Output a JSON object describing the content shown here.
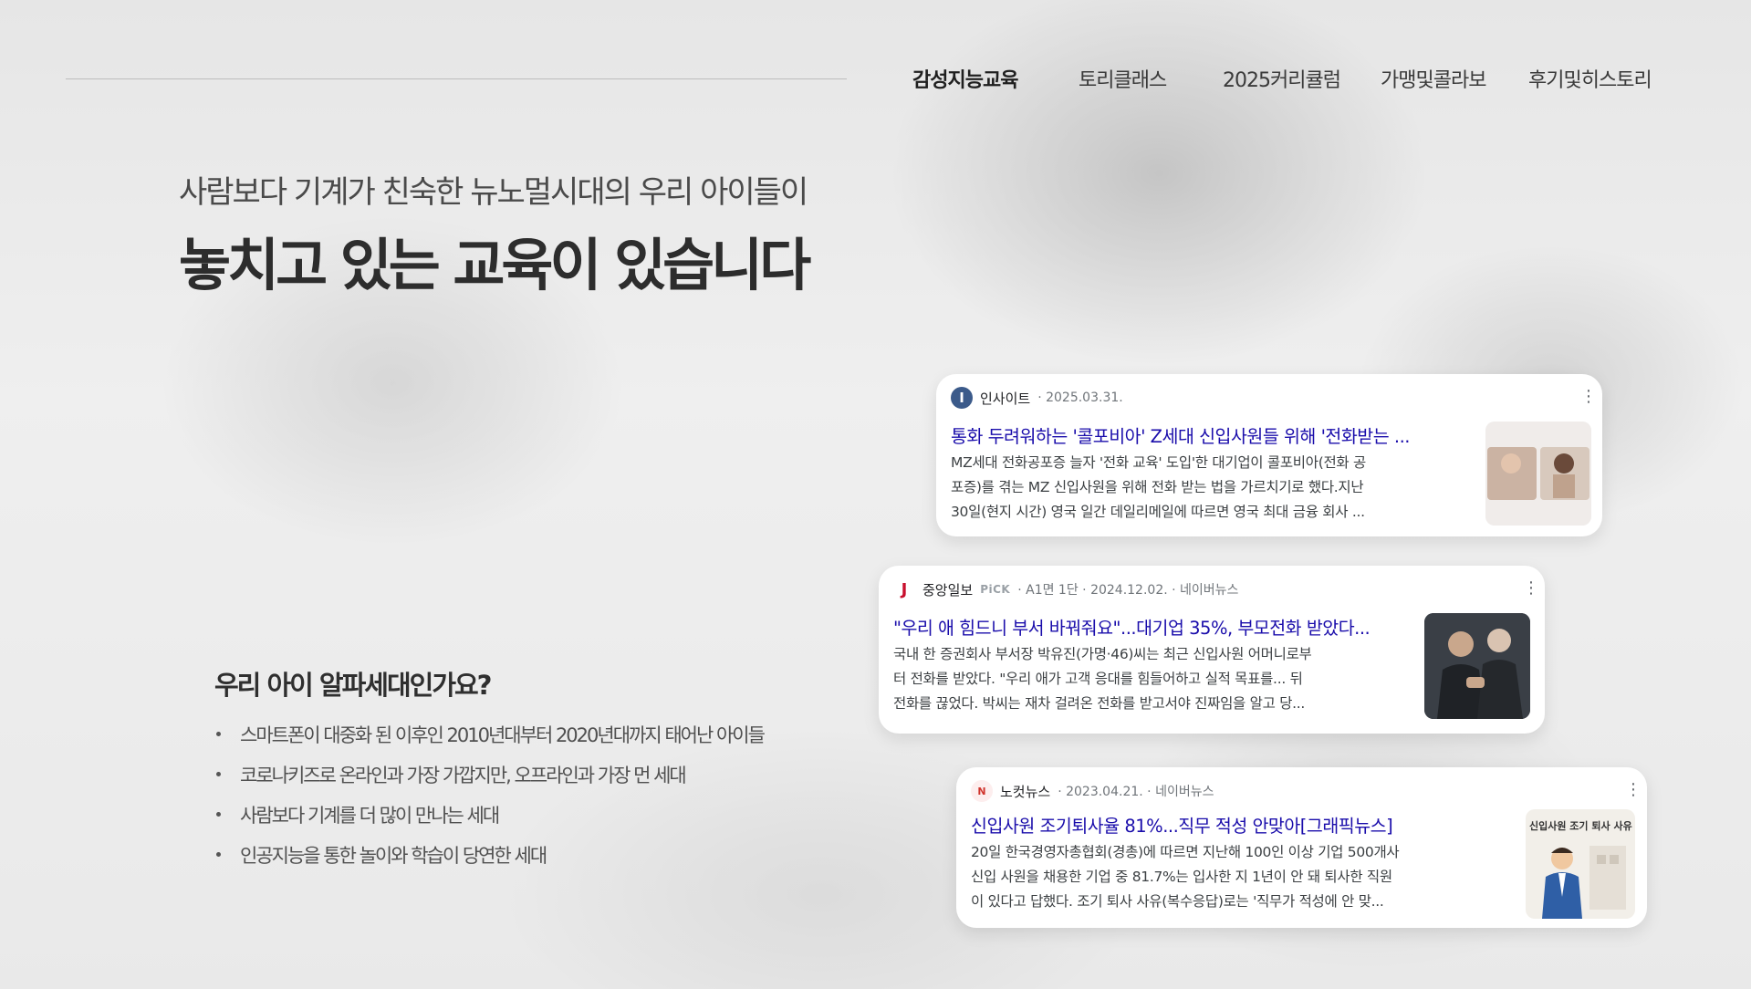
{
  "nav": {
    "items": [
      {
        "label": "감성지능교육",
        "active": true
      },
      {
        "label": "토리클래스",
        "active": false
      },
      {
        "label": "2025커리큘럼",
        "active": false
      },
      {
        "label": "가맹및콜라보",
        "active": false
      },
      {
        "label": "후기및히스토리",
        "active": false
      }
    ]
  },
  "hero": {
    "subhead": "사람보다 기계가 친숙한 뉴노멀시대의 우리 아이들이",
    "headline": "놓치고 있는 교육이 있습니다"
  },
  "alpha": {
    "title": "우리 아이 알파세대인가요?",
    "bullets": [
      "스마트폰이 대중화 된 이후인 2010년대부터 2020년대까지 태어난 아이들",
      "코로나키즈로 온라인과 가장 가깝지만, 오프라인과 가장 먼 세대",
      "사람보다 기계를 더 많이 만나는 세대",
      "인공지능을 통한 놀이와 학습이 당연한 세대"
    ]
  },
  "news": [
    {
      "source": "인사이트",
      "pick": "",
      "meta": "· 2025.03.31.",
      "logo_letter": "I",
      "logo_color": "#3b5a8a",
      "more_icon": "more-vert-icon",
      "title": "통화 두려워하는 '콜포비아' Z세대 신입사원들 위해 '전화받는 ...",
      "snippet": [
        "MZ세대 전화공포증 늘자 '전화 교육' 도입'한 대기업이 콜포비아(전화 공",
        "포증)를 겪는 MZ 신입사원을 위해 전화 받는 법을 가르치기로 했다.지난",
        "30일(현지 시간) 영국 일간 데일리메일에 따르면 영국 최대 금융 회사 ..."
      ]
    },
    {
      "source": "중앙일보",
      "pick": "PiCK",
      "meta": "· A1면 1단 · 2024.12.02. · 네이버뉴스",
      "logo_letter": "J",
      "logo_color": "#c8102e",
      "more_icon": "more-vert-icon",
      "title": "\"우리 애 힘드니 부서 바꿔줘요\"...대기업 35%, 부모전화 받았다...",
      "snippet": [
        "국내 한 증권회사 부서장 박유진(가명·46)씨는 최근 신입사원 어머니로부",
        "터 전화를 받았다. \"우리 애가 고객 응대를 힘들어하고 실적 목표를... 뒤",
        "전화를 끊었다. 박씨는 재차 걸려온 전화를 받고서야 진짜임을 알고 당..."
      ]
    },
    {
      "source": "노컷뉴스",
      "pick": "",
      "meta": "· 2023.04.21. · 네이버뉴스",
      "logo_letter": "N",
      "logo_color": "#d0342c",
      "more_icon": "more-vert-icon",
      "title": "신입사원 조기퇴사율 81%...직무 적성 안맞아[그래픽뉴스]",
      "snippet": [
        "20일 한국경영자총협회(경총)에 따르면 지난해 100인 이상 기업 500개사",
        "신입 사원을 채용한 기업 중 81.7%는 입사한 지 1년이 안 돼 퇴사한 직원",
        "이 있다고 답했다. 조기 퇴사 사유(복수응답)로는 '직무가 적성에 안 맞..."
      ],
      "thumb_caption": "신입사원 조기 퇴사 사유"
    }
  ],
  "colors": {
    "link": "#1a0dab",
    "meta": "#70757a"
  }
}
